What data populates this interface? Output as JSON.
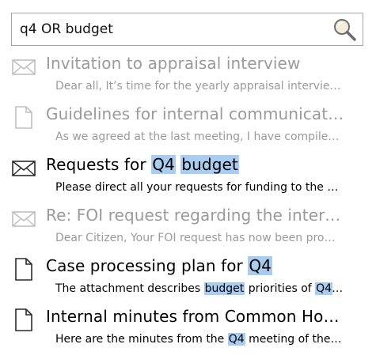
{
  "search": {
    "value": "q4 OR budget",
    "placeholder": ""
  },
  "results": [
    {
      "kind": "mail",
      "state": "dim",
      "title": [
        "Invitation to appraisal interview"
      ],
      "snippet": [
        "Dear all, It’s time for the yearly appraisal interview…"
      ]
    },
    {
      "kind": "document",
      "state": "dim",
      "title": [
        "Guidelines for internal communication"
      ],
      "snippet": [
        "As we agreed at the last meeting, I have compiled…"
      ]
    },
    {
      "kind": "mail",
      "state": "active",
      "title": [
        "Requests for ",
        "Q4",
        " ",
        "budget"
      ],
      "snippet": [
        "Please direct all your requests for funding to the s…"
      ]
    },
    {
      "kind": "mail",
      "state": "dim",
      "title": [
        "Re: FOI request regarding the internat…"
      ],
      "snippet": [
        "Dear Citizen, Your FOI request has now been pro…"
      ]
    },
    {
      "kind": "document",
      "state": "active",
      "title": [
        "Case processing plan for ",
        "Q4"
      ],
      "snippet": [
        "The attachment describes ",
        "budget",
        " priorities of ",
        "Q4",
        "…"
      ]
    },
    {
      "kind": "document",
      "state": "active",
      "title": [
        "Internal minutes from Common House…"
      ],
      "snippet": [
        "Here are the minutes from the ",
        "Q4",
        " meeting of the C…"
      ]
    }
  ],
  "highlight_color": "#a9cdf0",
  "dim_text_color": "#9a9a9a",
  "active_text_color": "#000000"
}
